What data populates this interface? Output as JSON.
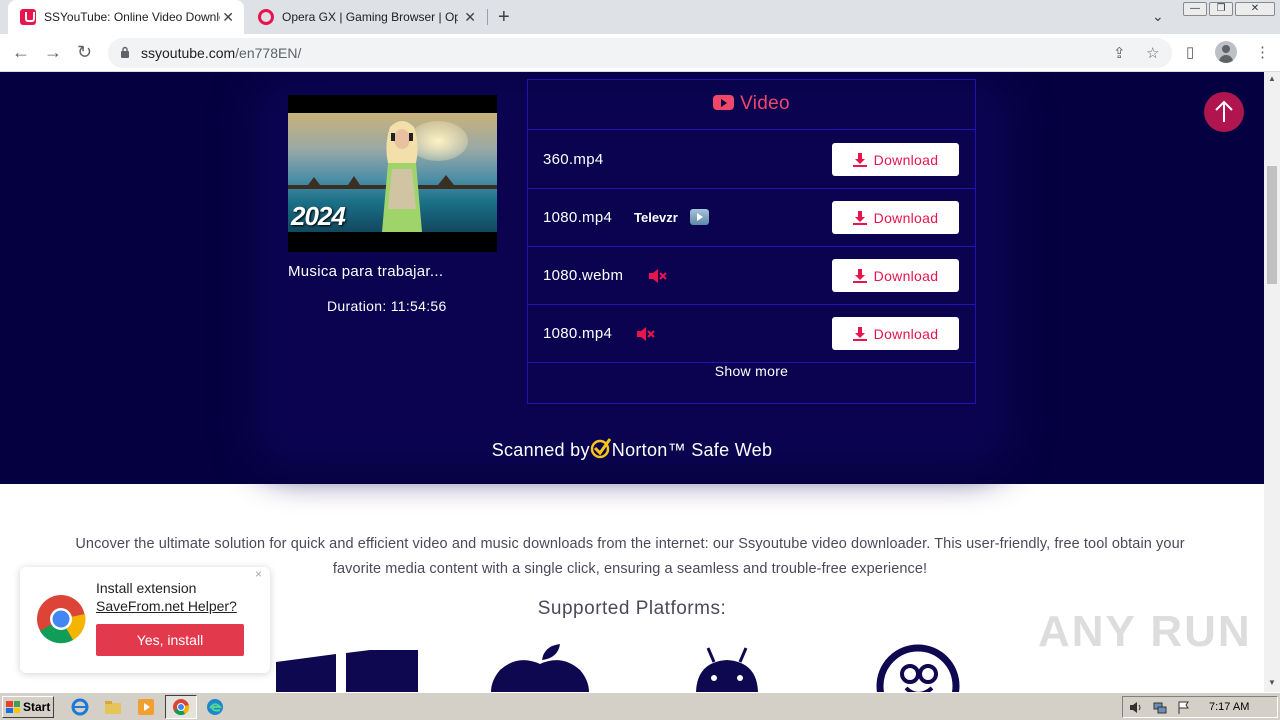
{
  "browser": {
    "tabs": [
      {
        "title": "SSYouTube: Online Video Downloade",
        "active": true
      },
      {
        "title": "Opera GX | Gaming Browser | Opera",
        "active": false
      }
    ],
    "url_host": "ssyoutube.com",
    "url_path": "/en778EN/",
    "window_controls": [
      "minimize",
      "restore",
      "close"
    ]
  },
  "video": {
    "thumbnail_text": "2024",
    "title": "Musica para trabajar...",
    "duration": "Duration: 11:54:56"
  },
  "formats": {
    "header": "Video",
    "rows": [
      {
        "format": "360.mp4",
        "tag": "",
        "muted": false
      },
      {
        "format": "1080.mp4",
        "tag": "Televzr",
        "muted": false
      },
      {
        "format": "1080.webm",
        "tag": "",
        "muted": true
      },
      {
        "format": "1080.mp4",
        "tag": "",
        "muted": true
      }
    ],
    "download_label": "Download",
    "show_more": "Show more"
  },
  "norton": {
    "prefix": "Scanned by",
    "brand": "Norton™ Safe Web"
  },
  "intro_text": "Uncover the ultimate solution for quick and efficient video and music downloads from the internet: our Ssyoutube video downloader. This user-friendly, free tool obtain your favorite media content with a single click, ensuring a seamless and trouble-free experience!",
  "platforms_heading": "Supported Platforms:",
  "platform_icons": [
    "windows-icon",
    "apple-icon",
    "android-icon",
    "linux-icon"
  ],
  "popup": {
    "line1": "Install extension",
    "line2": "SaveFrom.net Helper?",
    "button": "Yes, install",
    "close": "×"
  },
  "watermark": "ANY RUN",
  "taskbar": {
    "start_label": "Start",
    "time": "7:17 AM"
  },
  "colors": {
    "accent": "#e8144c",
    "page_dark": "#050040",
    "table_border": "#2510b8",
    "scroll_top_button": "#b0154f"
  }
}
